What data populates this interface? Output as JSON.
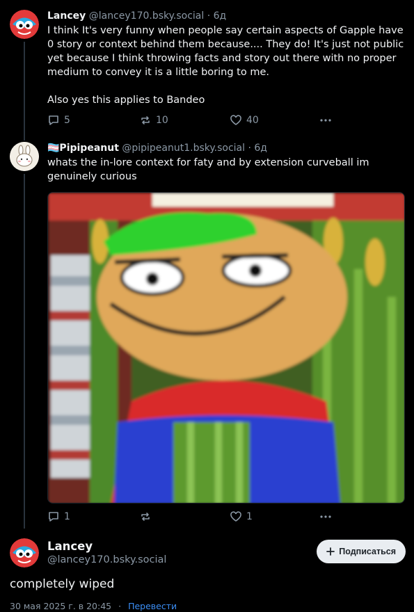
{
  "post1": {
    "name": "Lancey",
    "handle": "@lancey170.bsky.social",
    "separator": "·",
    "time": "6д",
    "text_p1": "I think It's very funny when people say certain aspects of Gapple have 0 story or context behind them because.... They do! It's just not public yet because I think throwing facts and story out there with no proper medium to convey it is a little boring to me.",
    "text_p2": "Also yes this applies to Bandeo",
    "replies": "5",
    "reposts": "10",
    "likes": "40"
  },
  "post2": {
    "name": "🏳️‍⚧️Pipipeanut",
    "handle": "@pipipeanut1.bsky.social",
    "separator": "·",
    "time": "6д",
    "text": "whats the in-lore context for faty and by extension curveball im genuinely curious",
    "replies": "1",
    "reposts": "",
    "likes": "1"
  },
  "main": {
    "name": "Lancey",
    "handle": "@lancey170.bsky.social",
    "follow_label": "Подписаться",
    "text": "completely wiped",
    "date": "30 мая 2025 г. в 20:45",
    "separator": "·",
    "translate": "Перевести"
  },
  "colors": {
    "background": "#000000",
    "muted": "#8b98a5",
    "link": "#3b8ef5",
    "thread_line": "#2a333d"
  },
  "icons": [
    "reply-icon",
    "repost-icon",
    "like-icon",
    "more-icon",
    "plus-icon"
  ]
}
